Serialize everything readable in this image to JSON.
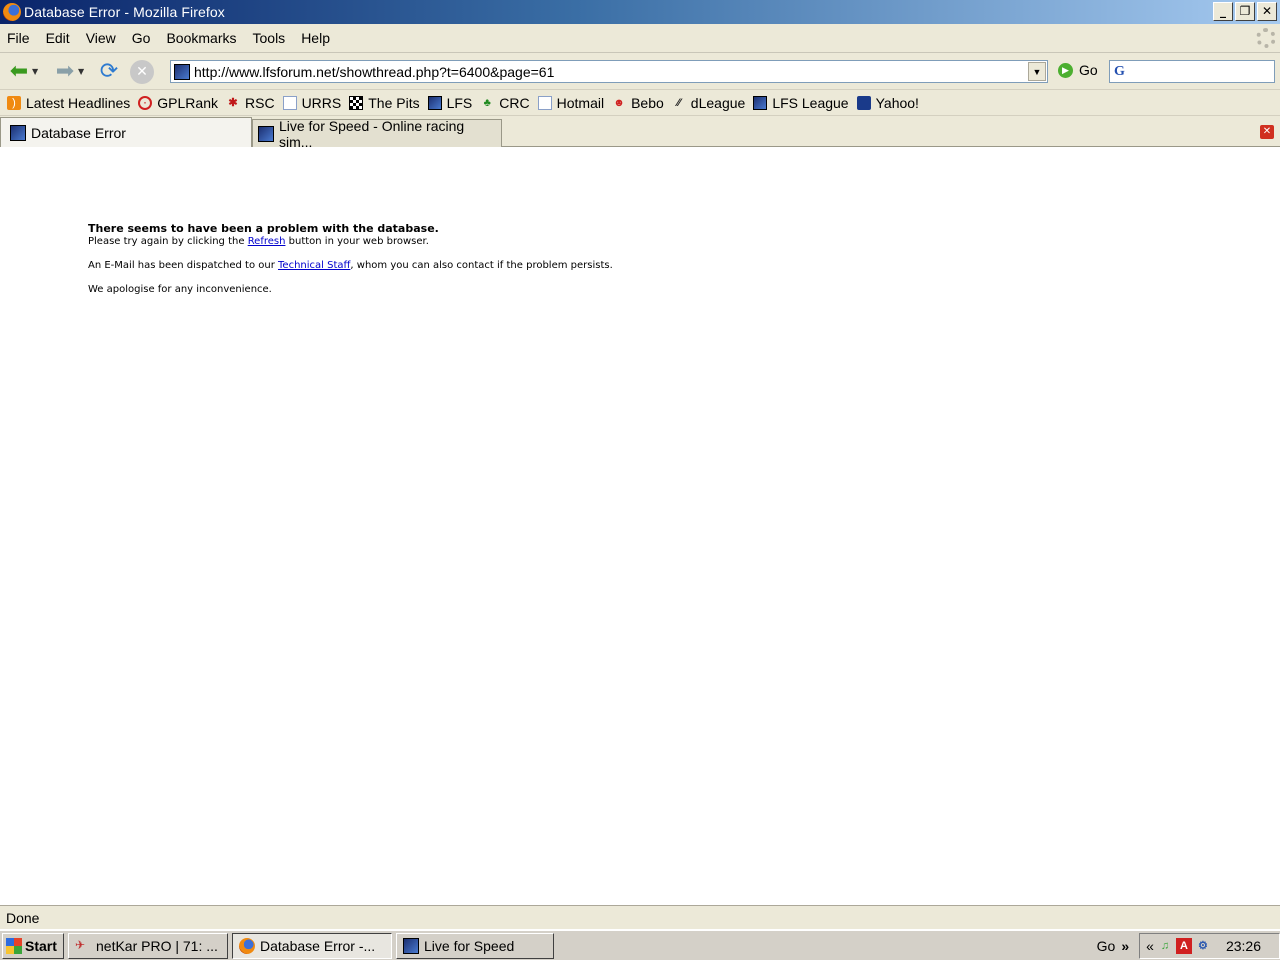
{
  "window": {
    "title": "Database Error - Mozilla Firefox"
  },
  "menu": [
    "File",
    "Edit",
    "View",
    "Go",
    "Bookmarks",
    "Tools",
    "Help"
  ],
  "nav": {
    "url": "http://www.lfsforum.net/showthread.php?t=6400&page=61",
    "go_label": "Go",
    "search_value": ""
  },
  "bookmarks": [
    "Latest Headlines",
    "GPLRank",
    "RSC",
    "URRS",
    "The Pits",
    "LFS",
    "CRC",
    "Hotmail",
    "Bebo",
    "dLeague",
    "LFS League",
    "Yahoo!"
  ],
  "tabs": [
    {
      "label": "Database Error",
      "active": true
    },
    {
      "label": "Live for Speed - Online racing sim...",
      "active": false
    }
  ],
  "content": {
    "heading": "There seems to have been a problem with the database.",
    "line1_pre": "Please try again by clicking the ",
    "line1_link": "Refresh",
    "line1_post": " button in your web browser.",
    "line2_pre": "An E-Mail has been dispatched to our ",
    "line2_link": "Technical Staff",
    "line2_post": ", whom you can also contact if the problem persists.",
    "line3": "We apologise for any inconvenience."
  },
  "status": {
    "text": "Done"
  },
  "taskbar": {
    "start_label": "Start",
    "tasks": [
      "netKar PRO | 71: ...",
      "Database Error -...",
      "Live for Speed"
    ],
    "go_label": "Go",
    "chevron": "»",
    "tray_chevron": "«",
    "clock": "23:26"
  }
}
